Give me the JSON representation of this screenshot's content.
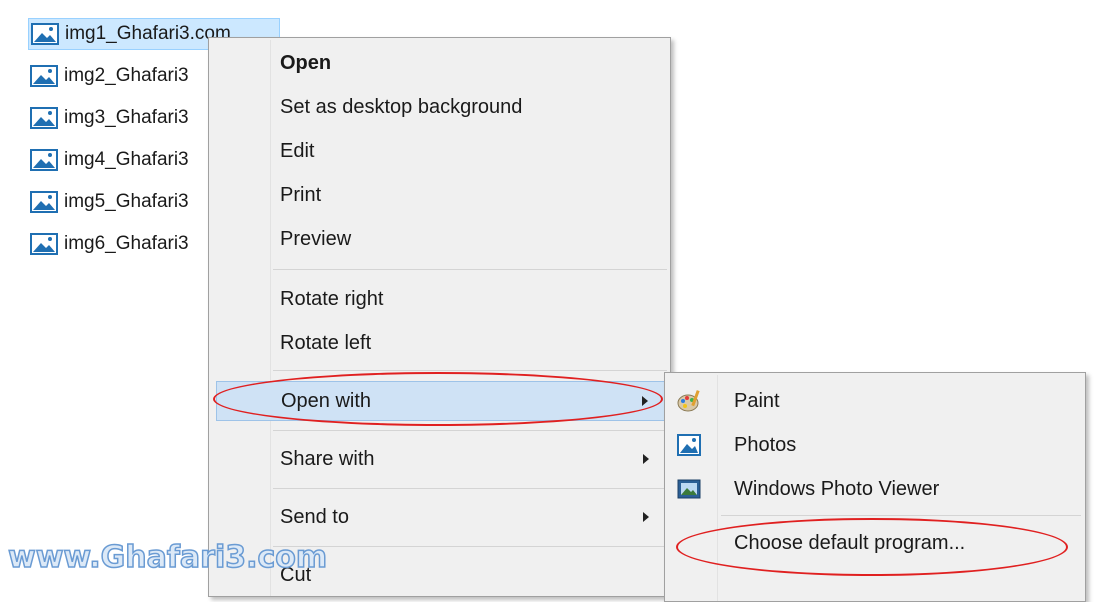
{
  "files": [
    {
      "name": "img1_Ghafari3.com",
      "icon": "image-file-icon",
      "selected": true
    },
    {
      "name": "img2_Ghafari3",
      "icon": "image-file-icon"
    },
    {
      "name": "img3_Ghafari3",
      "icon": "image-file-icon"
    },
    {
      "name": "img4_Ghafari3",
      "icon": "image-file-icon"
    },
    {
      "name": "img5_Ghafari3",
      "icon": "image-file-icon"
    },
    {
      "name": "img6_Ghafari3",
      "icon": "image-file-icon"
    }
  ],
  "context_menu": {
    "items": [
      {
        "label": "Open"
      },
      {
        "label": "Set as desktop background"
      },
      {
        "label": "Edit"
      },
      {
        "label": "Print"
      },
      {
        "label": "Preview"
      },
      {
        "label": "Rotate right"
      },
      {
        "label": "Rotate left"
      },
      {
        "label": "Open with"
      },
      {
        "label": "Share with"
      },
      {
        "label": "Send to"
      },
      {
        "label": "Cut"
      }
    ]
  },
  "open_with_submenu": {
    "items": [
      {
        "label": "Paint",
        "icon": "paint-palette-icon"
      },
      {
        "label": "Photos",
        "icon": "photos-app-icon"
      },
      {
        "label": "Windows Photo Viewer",
        "icon": "photo-viewer-icon"
      },
      {
        "label": "Choose default program..."
      }
    ]
  },
  "watermark": "www.Ghafari3.com",
  "colors": {
    "selection": "#cce8ff",
    "menu_bg": "#f0f0f0",
    "hover": "#cfe2f5",
    "highlight_ring": "#e02020"
  }
}
